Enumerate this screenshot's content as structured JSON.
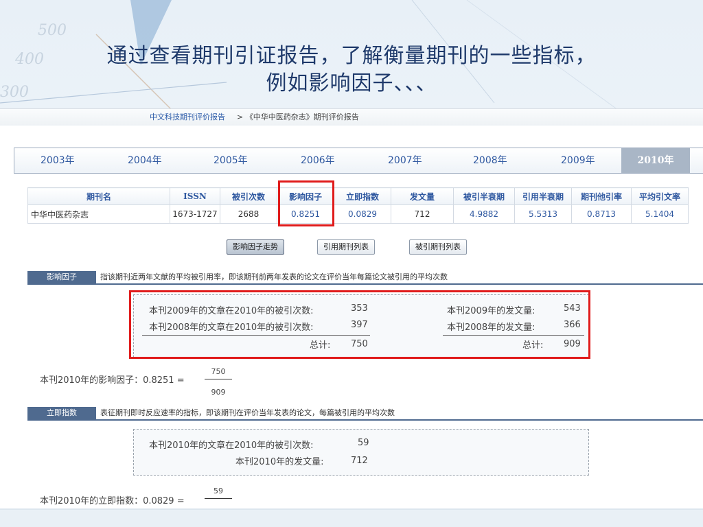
{
  "slide": {
    "title_line1": "通过查看期刊引证报告，了解衡量期刊的一些指标，",
    "title_line2": "例如影响因子、、、"
  },
  "deco_numbers": [
    "500",
    "400",
    "300"
  ],
  "breadcrumb": {
    "link": "中文科技期刊评价报告",
    "rest": "> 《中华中医药杂志》期刊评价报告"
  },
  "years": [
    "2003年",
    "2004年",
    "2005年",
    "2006年",
    "2007年",
    "2008年",
    "2009年",
    "2010年"
  ],
  "active_year": "2010年",
  "table": {
    "headers": [
      "期刊名",
      "ISSN",
      "被引次数",
      "影响因子",
      "立即指数",
      "发文量",
      "被引半衰期",
      "引用半衰期",
      "期刊他引率",
      "平均引文率"
    ],
    "row": [
      "中华中医药杂志",
      "1673-1727",
      "2688",
      "0.8251",
      "0.0829",
      "712",
      "4.9882",
      "5.5313",
      "0.8713",
      "5.1404"
    ]
  },
  "buttons": {
    "trend": "影响因子走势",
    "citing": "引用期刊列表",
    "cited": "被引期刊列表"
  },
  "impact": {
    "tag": "影响因子",
    "desc": "指该期刊近两年文献的平均被引用率，即该期刊前两年发表的论文在评价当年每篇论文被引用的平均次数",
    "l1_label": "本刊2009年的文章在2010年的被引次数:",
    "l1_value": "353",
    "l2_label": "本刊2008年的文章在2010年的被引次数:",
    "l2_value": "397",
    "l_total_label": "总计:",
    "l_total_value": "750",
    "r1_label": "本刊2009年的发文量:",
    "r1_value": "543",
    "r2_label": "本刊2008年的发文量:",
    "r2_value": "366",
    "r_total_label": "总计:",
    "r_total_value": "909",
    "formula_label": "本刊2010年的影响因子：0.8251 =",
    "numerator": "750",
    "denominator": "909"
  },
  "immediacy": {
    "tag": "立即指数",
    "desc": "表征期刊即时反应速率的指标，即该期刊在评价当年发表的论文，每篇被引用的平均次数",
    "l1_label": "本刊2010年的文章在2010年的被引次数:",
    "l1_value": "59",
    "l2_label": "本刊2010年的发文量:",
    "l2_value": "712",
    "formula_label": "本刊2010年的立即指数：0.0829 =",
    "numerator": "59"
  },
  "colors": {
    "highlight": "#e01b1b",
    "link": "#2f58a0",
    "section": "#4f6a8f"
  }
}
